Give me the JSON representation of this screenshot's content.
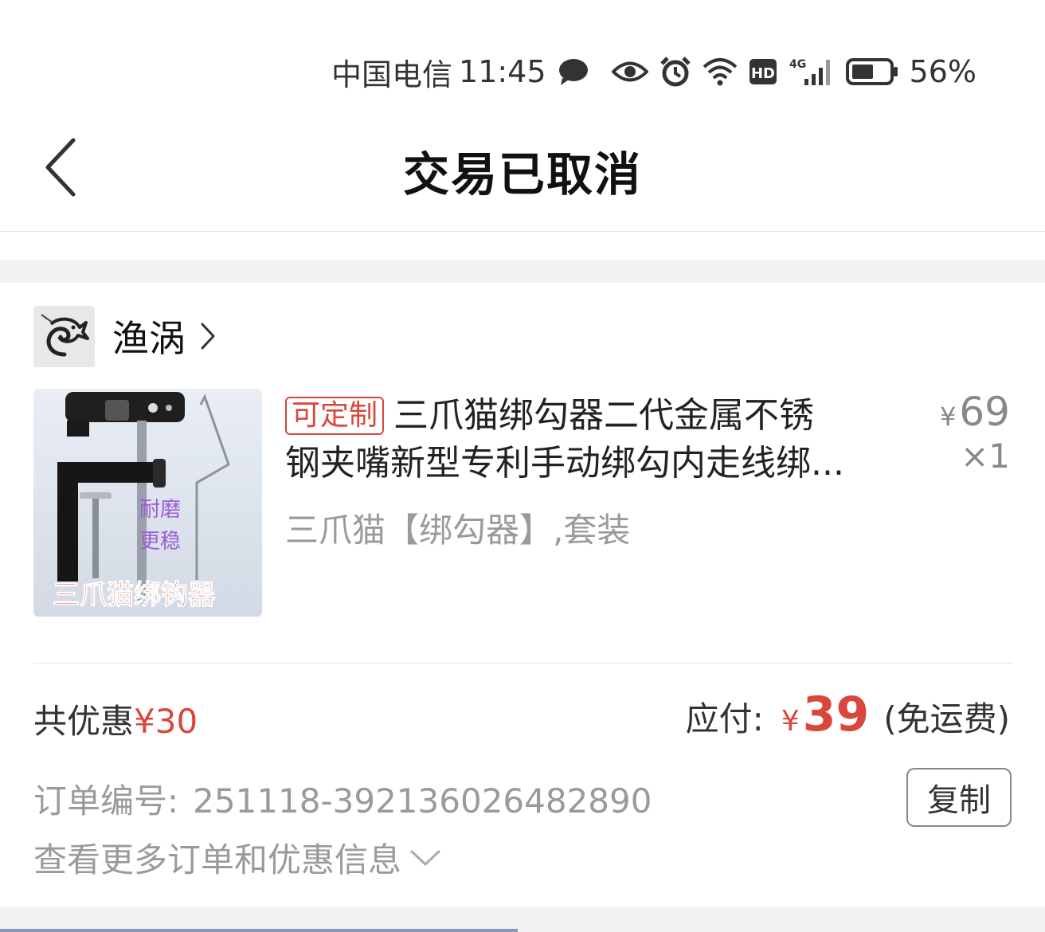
{
  "status_bar": {
    "carrier": "中国电信",
    "time": "11:45",
    "network": "4G",
    "hd": "HD",
    "battery": "56%",
    "icons": [
      "message-icon",
      "eye-icon",
      "alarm-icon",
      "wifi-icon",
      "hd-icon",
      "signal-icon",
      "battery-icon"
    ]
  },
  "navbar": {
    "back_icon": "chevron-left-icon",
    "title": "交易已取消"
  },
  "shop": {
    "name": "渔涡",
    "logo_icon": "fish-logo-icon",
    "chevron_icon": "chevron-right-icon"
  },
  "product": {
    "tag": "可定制",
    "title_line1": "三爪猫绑勾器二代金属不锈",
    "title_line2": "钢夹嘴新型专利手动绑勾内走线绑...",
    "variant": "三爪猫【绑勾器】,套装",
    "price_symbol": "¥",
    "price": "69",
    "quantity": "×1",
    "image_overlay": {
      "side_text1": "耐磨",
      "side_text2": "更稳",
      "caption": "三爪猫绑钩器"
    }
  },
  "summary": {
    "discount_label": "共优惠",
    "discount_value": "¥30",
    "pay_label": "应付:",
    "pay_symbol": "¥",
    "pay_amount": "39",
    "shipping_note": "(免运费)"
  },
  "order": {
    "number_label": "订单编号:",
    "number": "251118-392136026482890",
    "copy_label": "复制",
    "more_label": "查看更多订单和优惠信息"
  },
  "colors": {
    "accent_red": "#d9463b",
    "gray_text": "#9a9a9a",
    "background_gap": "#f2f2f2"
  }
}
